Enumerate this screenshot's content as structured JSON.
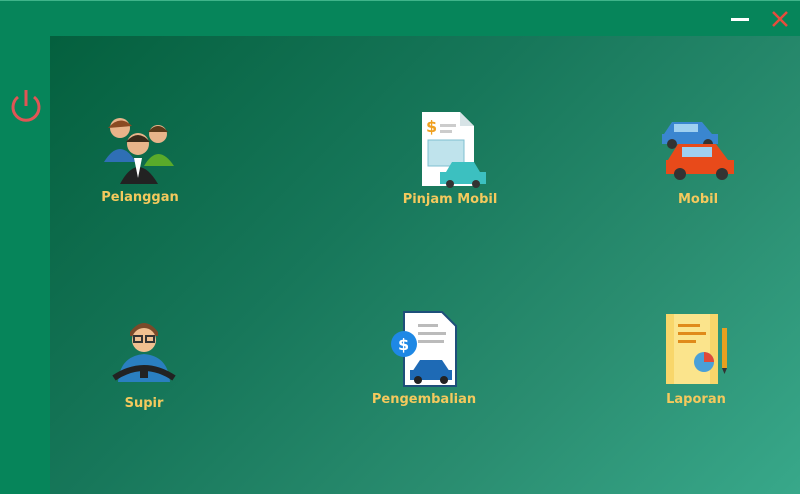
{
  "window": {
    "minimize_icon": "minimize-icon",
    "close_icon": "close-icon",
    "close_color": "#e74c3c"
  },
  "sidebar": {
    "power_icon": "power-icon",
    "power_color": "#e05555"
  },
  "menu": {
    "label_color": "#f4c95d",
    "items": [
      {
        "label": "Pelanggan",
        "icon": "customers-icon"
      },
      {
        "label": "Pinjam Mobil",
        "icon": "car-rental-invoice-icon"
      },
      {
        "label": "Mobil",
        "icon": "cars-icon"
      },
      {
        "label": "Supir",
        "icon": "driver-icon"
      },
      {
        "label": "Pengembalian",
        "icon": "car-return-invoice-icon"
      },
      {
        "label": "Laporan",
        "icon": "report-icon"
      }
    ]
  }
}
